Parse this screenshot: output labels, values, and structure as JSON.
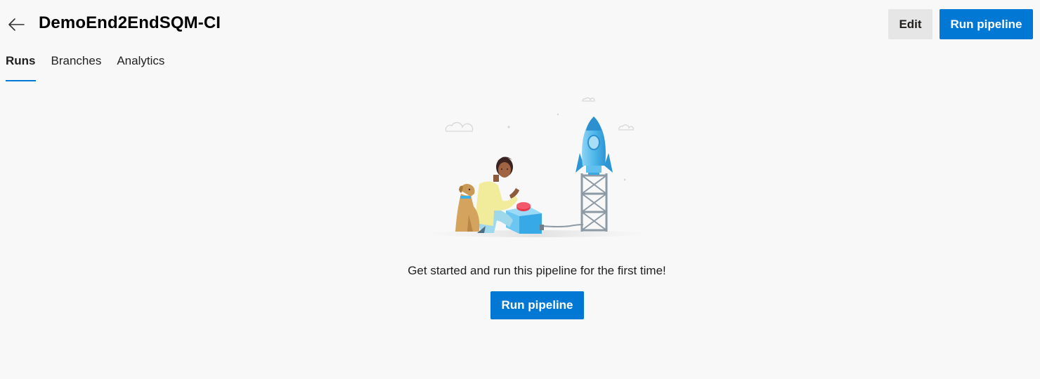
{
  "header": {
    "title": "DemoEnd2EndSQM-CI",
    "back_icon": "arrow-left-icon",
    "edit_label": "Edit",
    "run_label": "Run pipeline"
  },
  "tabs": [
    {
      "label": "Runs",
      "active": true
    },
    {
      "label": "Branches",
      "active": false
    },
    {
      "label": "Analytics",
      "active": false
    }
  ],
  "empty_state": {
    "illustration": "rocket-launch-illustration",
    "message": "Get started and run this pipeline for the first time!",
    "run_label": "Run pipeline"
  },
  "colors": {
    "accent": "#0078d4",
    "background": "#f8f8f8",
    "secondary_button": "#e6e6e6"
  }
}
